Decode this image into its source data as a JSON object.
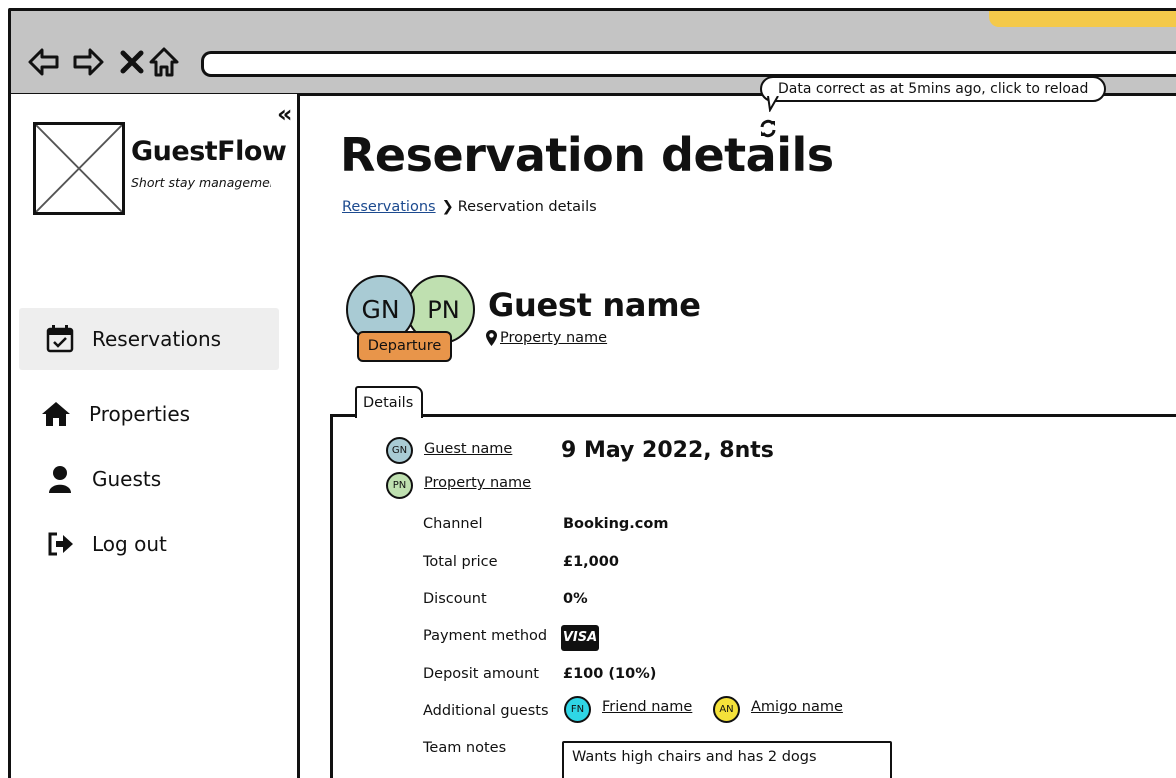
{
  "browser": {
    "icons": [
      "back-icon",
      "forward-icon",
      "close-icon",
      "home-icon"
    ]
  },
  "sidebar": {
    "brand_name": "GuestFlow",
    "brand_tagline": "Short stay managemen",
    "collapse_label": "«",
    "items": [
      {
        "label": "Reservations",
        "icon": "calendar-check-icon",
        "active": true
      },
      {
        "label": "Properties",
        "icon": "home-icon",
        "active": false
      },
      {
        "label": "Guests",
        "icon": "user-icon",
        "active": false
      },
      {
        "label": "Log out",
        "icon": "sign-out-icon",
        "active": false
      }
    ]
  },
  "header": {
    "title": "Reservation details",
    "data_notice": "Data correct as at 5mins ago, click to reload"
  },
  "breadcrumb": {
    "parent": "Reservations",
    "current": "Reservation details"
  },
  "reservation": {
    "guest_initials": "GN",
    "property_initials": "PN",
    "status_badge": "Departure",
    "guest_name": "Guest name",
    "property_name": "Property name",
    "date_summary": "9 May 2022, 8nts"
  },
  "tabs": [
    {
      "label": "Details"
    }
  ],
  "details": {
    "guest_link": "Guest name",
    "property_link": "Property name",
    "channel_label": "Channel",
    "channel_value": "Booking.com",
    "total_label": "Total price",
    "total_value": "£1,000",
    "discount_label": "Discount",
    "discount_value": "0%",
    "payment_label": "Payment method",
    "payment_value": "VISA",
    "deposit_label": "Deposit amount",
    "deposit_value": "£100 (10%)",
    "guests_label": "Additional guests",
    "additional_guests": [
      {
        "initials": "FN",
        "name": "Friend name",
        "color": "#2fd6e6"
      },
      {
        "initials": "AN",
        "name": "Amigo name",
        "color": "#f5e23a"
      }
    ],
    "notes_label": "Team notes",
    "notes_value": "Wants high chairs and has 2 dogs"
  },
  "colors": {
    "chrome": "#c4c4c4",
    "accent": "#f4c94a",
    "guest_avatar": "#a9cbd4",
    "property_avatar": "#bfe0b0",
    "departure_badge": "#e8954a",
    "link_blue": "#1c4a8f",
    "active_nav": "#eeeeee"
  }
}
